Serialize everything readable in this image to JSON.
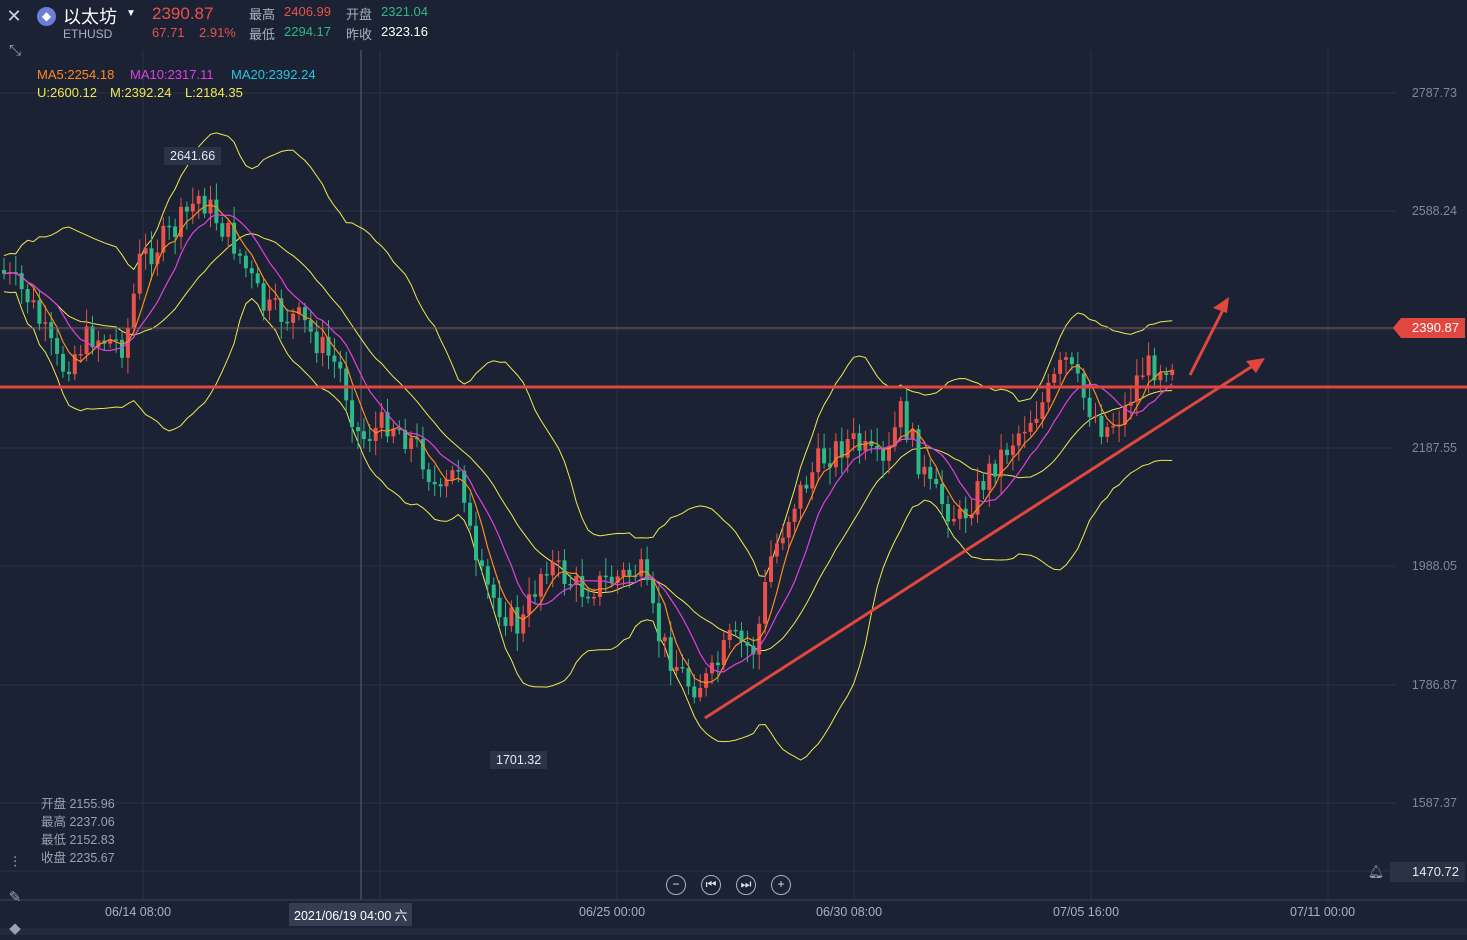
{
  "header": {
    "name": "以太坊",
    "symbol": "ETHUSD",
    "price": "2390.87",
    "change": "67.71",
    "change_pct": "2.91%",
    "high_label": "最高",
    "high": "2406.99",
    "open_label": "开盘",
    "open": "2321.04",
    "low_label": "最低",
    "low": "2294.17",
    "prev_label": "昨收",
    "prev_close": "2323.16"
  },
  "indicators": {
    "ma5": "MA5:2254.18",
    "ma10": "MA10:2317.11",
    "ma20": "MA20:2392.24",
    "boll_u": "U:2600.12",
    "boll_m": "M:2392.24",
    "boll_l": "L:2184.35"
  },
  "y_axis": [
    "2787.73",
    "2588.24",
    "2187.55",
    "1988.05",
    "1786.87",
    "1587.37"
  ],
  "price_tag": "2390.87",
  "low_tag": "1470.72",
  "extremes": {
    "max": "2641.66",
    "min": "1701.32"
  },
  "ohlc_hover": {
    "open": "开盘 2155.96",
    "high": "最高 2237.06",
    "low": "最低 2152.83",
    "close": "收盘 2235.67"
  },
  "x_axis": [
    "06/14 08:00",
    "06/25 00:00",
    "06/30 08:00",
    "07/05 16:00",
    "07/11 00:00"
  ],
  "x_highlight": "2021/06/19 04:00 六",
  "nav_icons": [
    "zoom-out-icon",
    "go-start-icon",
    "go-end-icon",
    "zoom-in-icon"
  ],
  "colors": {
    "up": "#e8524a",
    "down": "#2fb989",
    "ma5": "#ff8a1f",
    "ma10": "#e040e0",
    "boll": "#f0e84e",
    "trendline": "#e2473f"
  }
}
